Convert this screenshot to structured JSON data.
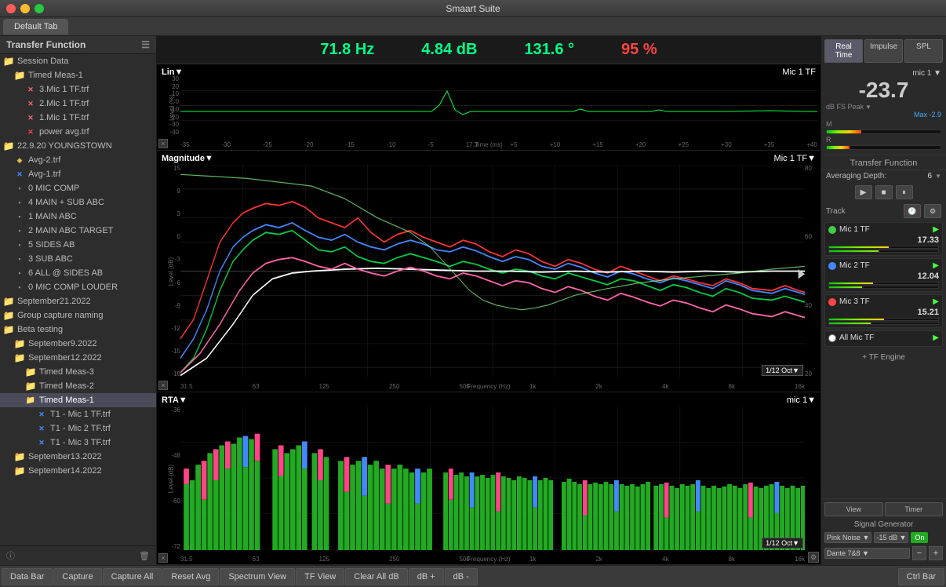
{
  "app": {
    "title": "Smaart Suite",
    "tab": "Default Tab"
  },
  "sidebar": {
    "title": "Transfer Function",
    "items": [
      {
        "id": "session-data",
        "label": "Session Data",
        "type": "folder",
        "indent": 0
      },
      {
        "id": "timed-meas-1-top",
        "label": "Timed Meas-1",
        "type": "folder",
        "indent": 1
      },
      {
        "id": "file-3mic",
        "label": "3.Mic 1 TF.trf",
        "type": "file-x",
        "indent": 2
      },
      {
        "id": "file-2mic",
        "label": "2.Mic 1 TF.trf",
        "type": "file-x",
        "indent": 2
      },
      {
        "id": "file-1mic",
        "label": "1.Mic 1 TF.trf",
        "type": "file-x",
        "indent": 2
      },
      {
        "id": "file-power",
        "label": "power avg.trf",
        "type": "file-x-red",
        "indent": 2
      },
      {
        "id": "folder-youngstown",
        "label": "22.9.20 YOUNGSTOWN",
        "type": "folder",
        "indent": 0
      },
      {
        "id": "file-avg2",
        "label": "Avg-2.trf",
        "type": "file-yellow",
        "indent": 1
      },
      {
        "id": "file-avg1",
        "label": "Avg-1.trf",
        "type": "file-x-blue",
        "indent": 1
      },
      {
        "id": "file-0mic",
        "label": "0 MIC COMP",
        "type": "file-plain",
        "indent": 1
      },
      {
        "id": "file-4main",
        "label": "4 MAIN + SUB ABC",
        "type": "file-plain",
        "indent": 1
      },
      {
        "id": "file-1main",
        "label": "1 MAIN ABC",
        "type": "file-plain",
        "indent": 1
      },
      {
        "id": "file-2main",
        "label": "2 MAIN ABC TARGET",
        "type": "file-plain",
        "indent": 1
      },
      {
        "id": "file-5sides",
        "label": "5 SIDES AB",
        "type": "file-plain",
        "indent": 1
      },
      {
        "id": "file-3sub",
        "label": "3 SUB ABC",
        "type": "file-plain",
        "indent": 1
      },
      {
        "id": "file-6all",
        "label": "6 ALL @ SIDES AB",
        "type": "file-plain",
        "indent": 1
      },
      {
        "id": "file-0miclouder",
        "label": "0 MIC COMP LOUDER",
        "type": "file-plain",
        "indent": 1
      },
      {
        "id": "folder-sep21",
        "label": "September21.2022",
        "type": "folder",
        "indent": 0
      },
      {
        "id": "group-capture",
        "label": "Group capture naming",
        "type": "folder-plain",
        "indent": 0
      },
      {
        "id": "folder-beta",
        "label": "Beta testing",
        "type": "folder",
        "indent": 0
      },
      {
        "id": "folder-sep9",
        "label": "September9.2022",
        "type": "folder",
        "indent": 1
      },
      {
        "id": "folder-sep12",
        "label": "September12.2022",
        "type": "folder",
        "indent": 1
      },
      {
        "id": "folder-timed3",
        "label": "Timed Meas-3",
        "type": "folder",
        "indent": 2
      },
      {
        "id": "folder-timed2",
        "label": "Timed Meas-2",
        "type": "folder",
        "indent": 2
      },
      {
        "id": "folder-timed1-sel",
        "label": "Timed Meas-1",
        "type": "folder-sel",
        "indent": 2,
        "selected": true
      },
      {
        "id": "file-t1mic1",
        "label": "T1 - Mic 1 TF.trf",
        "type": "file-x-blue",
        "indent": 3
      },
      {
        "id": "file-t1mic2",
        "label": "T1 - Mic 2 TF.trf",
        "type": "file-x-blue",
        "indent": 3
      },
      {
        "id": "file-t1mic3",
        "label": "T1 - Mic 3 TF.trf",
        "type": "file-x-blue",
        "indent": 3
      },
      {
        "id": "folder-sep13",
        "label": "September13.2022",
        "type": "folder",
        "indent": 1
      },
      {
        "id": "folder-sep14",
        "label": "September14.2022",
        "type": "folder",
        "indent": 1
      }
    ]
  },
  "metrics": {
    "frequency": "71.8 Hz",
    "level_db": "4.84 dB",
    "phase_deg": "131.6 °",
    "coherence_pct": "95 %"
  },
  "impulse_chart": {
    "title": "Lin▼",
    "label_right": "Mic 1 TF",
    "y_axis": [
      "30",
      "20",
      "10",
      "0",
      "-10",
      "-20",
      "-30",
      "-40"
    ],
    "y_unit": "Level (%)",
    "x_axis": [
      "-35",
      "-30",
      "-25",
      "-20",
      "-15",
      "-10",
      "-5",
      "17.3",
      "+5",
      "+10",
      "+15",
      "+20",
      "+25",
      "+30",
      "+35",
      "+40"
    ],
    "x_unit": "Time (ms)"
  },
  "magnitude_chart": {
    "title": "Magnitude▼",
    "label_right": "Mic 1 TF▼",
    "y_axis_left": [
      "15",
      "9",
      "3",
      "0",
      "-3",
      "-6",
      "-9",
      "-12",
      "-15",
      "-18"
    ],
    "y_axis_right": [
      "80",
      "60",
      "40",
      "20"
    ],
    "y_unit": "Level (dB)",
    "x_axis": [
      "31.5",
      "63",
      "125",
      "250",
      "500",
      "1k",
      "2k",
      "4k",
      "8k",
      "16k"
    ],
    "x_unit": "Frequency (Hz)",
    "resolution": "1/12 Oct▼"
  },
  "rta_chart": {
    "title": "RTA▼",
    "label_right": "mic 1▼",
    "y_axis": [
      "-36",
      "-48",
      "-60",
      "-72"
    ],
    "y_unit": "Level (dB)",
    "x_axis": [
      "31.5",
      "63",
      "125",
      "250",
      "500",
      "1k",
      "2k",
      "4k",
      "8k",
      "16k"
    ],
    "x_unit": "Frequency (Hz)",
    "resolution": "1/12 Oct▼"
  },
  "rightpanel": {
    "buttons": [
      "Real Time",
      "Impulse",
      "SPL"
    ],
    "active_button": "Real Time",
    "mic_select": "mic 1",
    "meter_value": "-23.7",
    "meter_unit": "dB FS Peak",
    "meter_max": "Max -2.9",
    "tf_section": "Transfer Function",
    "avg_depth_label": "Averaging Depth:",
    "avg_depth_value": "6",
    "track_label": "Track",
    "mics": [
      {
        "name": "Mic 1 TF",
        "color": "#44cc44",
        "value": "17.33",
        "m_pct": 55,
        "r_pct": 45
      },
      {
        "name": "Mic 2 TF",
        "color": "#4488ff",
        "value": "12.04",
        "m_pct": 40,
        "r_pct": 30
      },
      {
        "name": "Mic 3 TF",
        "color": "#ff4444",
        "value": "15.21",
        "m_pct": 50,
        "r_pct": 38
      },
      {
        "name": "All Mic TF",
        "color": "#ffffff",
        "value": "",
        "m_pct": 0,
        "r_pct": 0
      }
    ],
    "add_tf_engine": "+ TF Engine",
    "view_btn": "View",
    "timer_btn": "Timer",
    "signal_generator": "Signal Generator",
    "sig_type": "Pink Noise",
    "sig_level": "-15 dB",
    "sig_on": "On",
    "sig_output": "Dante 7&8"
  },
  "bottombar": {
    "buttons": [
      "Data Bar",
      "Capture",
      "Capture All",
      "Reset Avg",
      "Spectrum View",
      "TF View",
      "Clear All dB",
      "dB +",
      "dB -",
      "Ctrl Bar"
    ]
  }
}
